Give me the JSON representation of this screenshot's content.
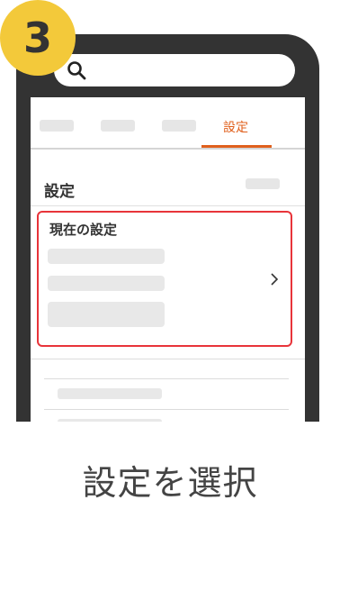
{
  "step_number": "3",
  "caption": "設定を選択",
  "tabs": {
    "active_label": "設定"
  },
  "section": {
    "title": "設定"
  },
  "card": {
    "title": "現在の設定"
  },
  "colors": {
    "accent": "#e0601d",
    "highlight_border": "#e8343a",
    "badge": "#f3c93a",
    "phone_frame": "#333333"
  },
  "icons": {
    "search": "search-icon",
    "chevron": "chevron-right-icon"
  }
}
